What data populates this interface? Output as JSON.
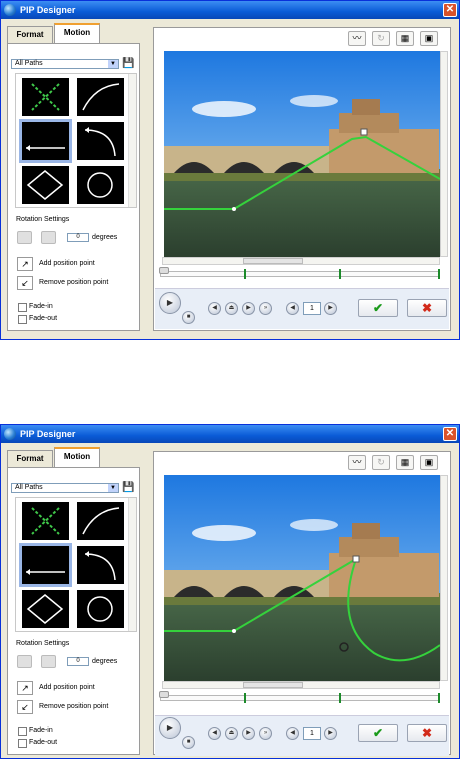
{
  "window": {
    "title": "PIP Designer"
  },
  "tabs": [
    {
      "label": "Format"
    },
    {
      "label": "Motion"
    }
  ],
  "path_filter": {
    "selected": "All Paths"
  },
  "rotation": {
    "label": "Rotation Settings",
    "degrees_label": "degrees",
    "degrees_value": "0"
  },
  "actions": {
    "add_label": "Add position point",
    "remove_label": "Remove position point"
  },
  "fade": {
    "in_label": "Fade-in",
    "out_label": "Fade-out"
  },
  "playback": {
    "frame": "1"
  },
  "colors": {
    "accent": "#0a5bd6",
    "path": "#35d23c",
    "confirm": "#1a9a1a",
    "cancel": "#d22a1a"
  }
}
